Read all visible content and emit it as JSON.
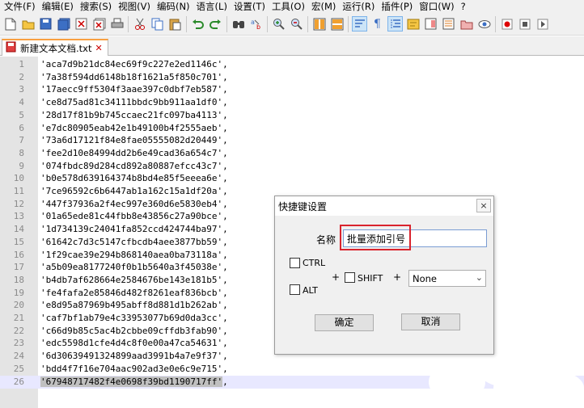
{
  "menu": [
    "文件(F)",
    "编辑(E)",
    "搜索(S)",
    "视图(V)",
    "编码(N)",
    "语言(L)",
    "设置(T)",
    "工具(O)",
    "宏(M)",
    "运行(R)",
    "插件(P)",
    "窗口(W)",
    "?"
  ],
  "toolbar_icons": [
    "new-file-icon",
    "open-file-icon",
    "save-icon",
    "save-all-icon",
    "close-icon",
    "close-all-icon",
    "print-icon",
    "cut-icon",
    "copy-icon",
    "paste-icon",
    "undo-icon",
    "redo-icon",
    "find-icon",
    "replace-icon",
    "zoom-in-icon",
    "zoom-out-icon",
    "sync-vertical-icon",
    "sync-horizontal-icon",
    "word-wrap-icon",
    "show-all-chars-icon",
    "indent-guide-icon",
    "user-defined-language-icon",
    "document-map-icon",
    "function-list-icon",
    "folder-as-workspace-icon",
    "monitoring-icon",
    "record-macro-icon",
    "stop-record-icon",
    "play-macro-icon"
  ],
  "tab": {
    "title": "新建文本文档.txt",
    "close": "✕"
  },
  "lines": [
    "'aca7d9b21dc84ec69f9c227e2ed1146c',",
    "'7a38f594dd6148b18f1621a5f850c701',",
    "'17aecc9ff5304f3aae397c0dbf7eb587',",
    "'ce8d75ad81c34111bbdc9bb911aa1df0',",
    "'28d17f81b9b745ccaec21fc097ba4113',",
    "'e7dc80905eab42e1b49100b4f2555aeb',",
    "'73a6d17121f84e8fae05555082d20449',",
    "'fee2d10e84994dd2b6e49cad36a654c7',",
    "'074fbdc89d284cd892a80887efcc43c7',",
    "'b0e578d639164374b8bd4e85f5eeea6e',",
    "'7ce96592c6b6447ab1a162c15a1df20a',",
    "'447f37936a2f4ec997e360d6e5830eb4',",
    "'01a65ede81c44fbb8e43856c27a90bce',",
    "'1d734139c24041fa852ccd424744ba97',",
    "'61642c7d3c5147cfbcdb4aee3877bb59',",
    "'1f29cae39e294b868140aea0ba73118a',",
    "'a5b09ea8177240f0b1b5640a3f45038e',",
    "'b4db7af628664e2584676be143e181b5',",
    "'fe4fafa2e85846d482f8261eaf836bcb',",
    "'e8d95a87969b495abff8d881d1b262ab',",
    "'caf7bf1ab79e4c33953077b69d0da3cc',",
    "'c66d9b85c5ac4b2cbbe09cffdb3fab90',",
    "'edc5598d1cfe4d4c8f0e00a47ca54631',",
    "'6d30639491324899aad3991b4a7e9f37',",
    "'bdd4f7f16e704aac902ad3e0e6c9e715',",
    "'67948717482f4e0698f39bd1190717ff',"
  ],
  "current_line": {
    "number": "26",
    "selected_text": "'67948717482f4e0698f39bd1190717ff'",
    "rest": ","
  },
  "dialog": {
    "title": "快捷键设置",
    "close": "×",
    "name_label": "名称",
    "name_value": "批量添加引号",
    "ctrl_label": "CTRL",
    "alt_label": "ALT",
    "shift_label": "SHIFT",
    "plus1": "+",
    "plus2": "+",
    "key_value": "None",
    "ok_label": "确定",
    "cancel_label": "取消"
  },
  "colors": {
    "tab_accent": "#f9a040",
    "highlight_border": "#d9232d",
    "current_line_bg": "#e8e8ff",
    "selection_bg": "#c0c0c0"
  }
}
